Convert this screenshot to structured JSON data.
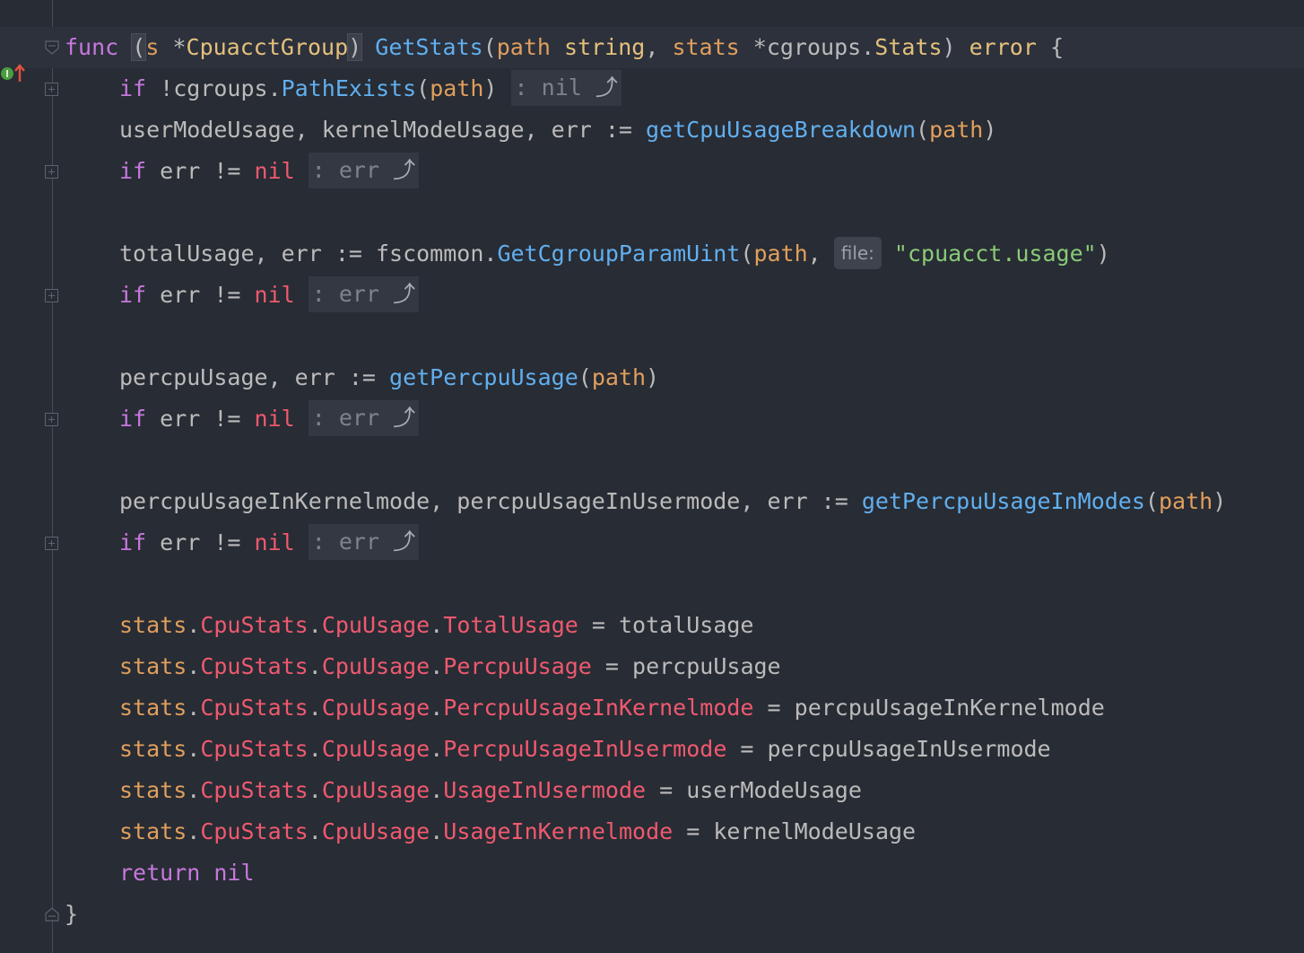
{
  "editor": {
    "language": "go",
    "colors": {
      "background": "#282c34",
      "keyword": "#c678dd",
      "function": "#61afef",
      "parameter": "#e09f5d",
      "type": "#e5c07b",
      "nil": "#ef596f",
      "string": "#89ca78",
      "text": "#bbbbbb",
      "hint": "#7e838b"
    },
    "gutter": {
      "implements_icon": "implements-up-icon"
    },
    "hints": {
      "pathexists_return": ": nil",
      "err_return": ": err",
      "file_param": "file:"
    },
    "lines": {
      "l1": {
        "func": "func",
        "open_paren": "(",
        "receiver": "s",
        "star": " *",
        "recv_type": "CpuacctGroup",
        "close_paren": ")",
        "space": " ",
        "name": "GetStats",
        "p_open": "(",
        "param1": "path",
        "sp1": " ",
        "type1": "string",
        "comma": ", ",
        "param2": "stats",
        "star2": " *",
        "pkg2": "cgroups.",
        "type2": "Stats",
        "p_close": ")",
        "ret_sp": " ",
        "ret": "error",
        "brace": " {"
      },
      "l2": {
        "if": "if",
        "rest1": " !cgroups.",
        "fn": "PathExists",
        "po": "(",
        "arg": "path",
        "pc": ")",
        "sp": " "
      },
      "l3": {
        "vars": "userModeUsage, kernelModeUsage, err := ",
        "fn": "getCpuUsageBreakdown",
        "po": "(",
        "arg": "path",
        "pc": ")"
      },
      "l4": {
        "if": "if",
        "cond": " err != ",
        "nil": "nil",
        "sp": " "
      },
      "l6": {
        "vars": "totalUsage, err := fscommon.",
        "fn": "GetCgroupParamUint",
        "po": "(",
        "arg": "path",
        "comma": ",",
        "str": "\"cpuacct.usage\"",
        "pc": ")"
      },
      "l7": {
        "if": "if",
        "cond": " err != ",
        "nil": "nil",
        "sp": " "
      },
      "l9": {
        "vars": "percpuUsage, err := ",
        "fn": "getPercpuUsage",
        "po": "(",
        "arg": "path",
        "pc": ")"
      },
      "l10": {
        "if": "if",
        "cond": " err != ",
        "nil": "nil",
        "sp": " "
      },
      "l12": {
        "vars": "percpuUsageInKernelmode, percpuUsageInUsermode, err := ",
        "fn": "getPercpuUsageInModes",
        "po": "(",
        "arg": "path",
        "pc": ")"
      },
      "l13": {
        "if": "if",
        "cond": " err != ",
        "nil": "nil",
        "sp": " "
      },
      "l15": {
        "obj": "stats",
        "d1": ".",
        "f1": "CpuStats",
        "d2": ".",
        "f2": "CpuUsage",
        "d3": ".",
        "f3": "TotalUsage",
        "rhs": " = totalUsage"
      },
      "l16": {
        "obj": "stats",
        "d1": ".",
        "f1": "CpuStats",
        "d2": ".",
        "f2": "CpuUsage",
        "d3": ".",
        "f3": "PercpuUsage",
        "rhs": " = percpuUsage"
      },
      "l17": {
        "obj": "stats",
        "d1": ".",
        "f1": "CpuStats",
        "d2": ".",
        "f2": "CpuUsage",
        "d3": ".",
        "f3": "PercpuUsageInKernelmode",
        "rhs": " = percpuUsageInKernelmode"
      },
      "l18": {
        "obj": "stats",
        "d1": ".",
        "f1": "CpuStats",
        "d2": ".",
        "f2": "CpuUsage",
        "d3": ".",
        "f3": "PercpuUsageInUsermode",
        "rhs": " = percpuUsageInUsermode"
      },
      "l19": {
        "obj": "stats",
        "d1": ".",
        "f1": "CpuStats",
        "d2": ".",
        "f2": "CpuUsage",
        "d3": ".",
        "f3": "UsageInUsermode",
        "rhs": " = userModeUsage"
      },
      "l20": {
        "obj": "stats",
        "d1": ".",
        "f1": "CpuStats",
        "d2": ".",
        "f2": "CpuUsage",
        "d3": ".",
        "f3": "UsageInKernelmode",
        "rhs": " = kernelModeUsage"
      },
      "l21": {
        "ret": "return",
        "sp": " ",
        "nil": "nil"
      },
      "l22": {
        "brace": "}"
      }
    }
  }
}
